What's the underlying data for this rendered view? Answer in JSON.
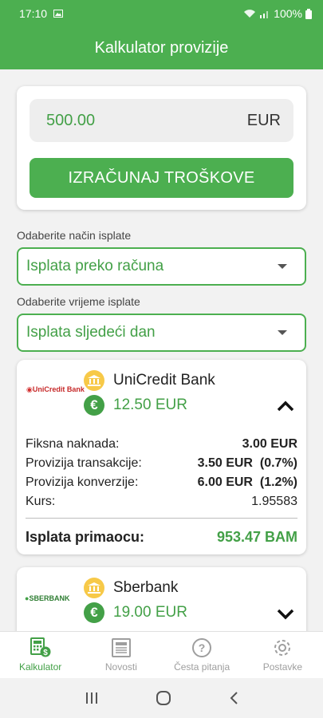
{
  "status": {
    "time": "17:10",
    "battery": "100%"
  },
  "appbar": {
    "title": "Kalkulator provizije"
  },
  "amount": {
    "value": "500.00",
    "currency": "EUR",
    "button": "IZRAČUNAJ TROŠKOVE"
  },
  "payment_method": {
    "label": "Odaberite način isplate",
    "selected": "Isplata preko računa"
  },
  "payment_time": {
    "label": "Odaberite vrijeme isplate",
    "selected": "Isplata sljedeći dan"
  },
  "banks": [
    {
      "logo": "UniCredit Bank",
      "name": "UniCredit Bank",
      "fee": "12.50 EUR",
      "expanded": true,
      "details": [
        {
          "label": "Fiksna naknada:",
          "value": "3.00 EUR",
          "extra": ""
        },
        {
          "label": "Provizija transakcije:",
          "value": "3.50 EUR",
          "extra": "(0.7%)"
        },
        {
          "label": "Provizija konverzije:",
          "value": "6.00 EUR",
          "extra": "(1.2%)"
        },
        {
          "label": "Kurs:",
          "value": "1.95583",
          "extra": ""
        }
      ],
      "payout_label": "Isplata primaocu:",
      "payout_value": "953.47 BAM"
    },
    {
      "logo": "SBERBANK",
      "name": "Sberbank",
      "fee": "19.00 EUR",
      "expanded": false
    }
  ],
  "nav": [
    {
      "label": "Kalkulator",
      "icon": "calculator-icon",
      "active": true
    },
    {
      "label": "Novosti",
      "icon": "newspaper-icon",
      "active": false
    },
    {
      "label": "Česta pitanja",
      "icon": "help-icon",
      "active": false
    },
    {
      "label": "Postavke",
      "icon": "gear-icon",
      "active": false
    }
  ],
  "colors": {
    "primary": "#4caf50",
    "accent_text": "#43a047",
    "coin_gold": "#f7c948"
  }
}
